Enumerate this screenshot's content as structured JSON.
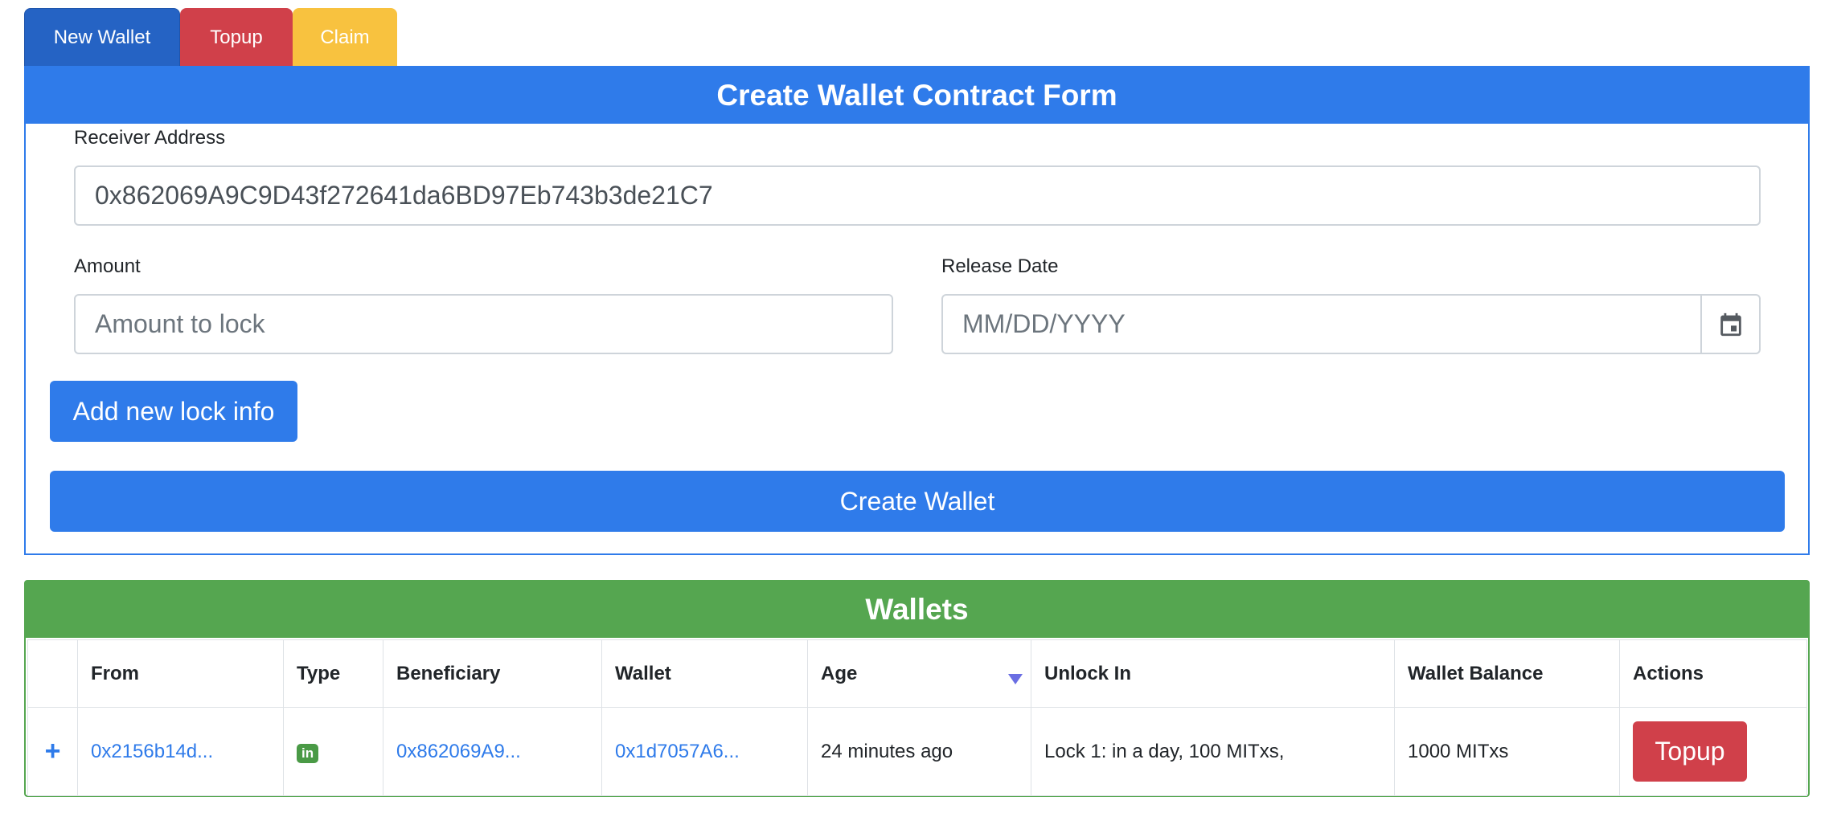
{
  "tabs": [
    {
      "label": "New Wallet",
      "color": "#2563c4"
    },
    {
      "label": "Topup",
      "color": "#d0404a"
    },
    {
      "label": "Claim",
      "color": "#f8c23f"
    }
  ],
  "form": {
    "title": "Create Wallet Contract Form",
    "receiver_label": "Receiver Address",
    "receiver_value": "0x862069A9C9D43f272641da6BD97Eb743b3de21C7",
    "amount_label": "Amount",
    "amount_placeholder": "Amount to lock",
    "release_label": "Release Date",
    "release_placeholder": "MM/DD/YYYY",
    "calendar_icon": "calendar-icon",
    "add_lock_label": "Add new lock info",
    "create_label": "Create Wallet",
    "accent_color": "#2f7bea"
  },
  "wallets": {
    "title": "Wallets",
    "accent_color": "#55a650",
    "columns": [
      "",
      "From",
      "Type",
      "Beneficiary",
      "Wallet",
      "Age",
      "Unlock In",
      "Wallet Balance",
      "Actions"
    ],
    "sorted_column": "Age",
    "rows": [
      {
        "expand": "+",
        "from": "0x2156b14d...",
        "type": "in",
        "beneficiary": "0x862069A9...",
        "wallet": "0x1d7057A6...",
        "age": "24 minutes ago",
        "unlock_in": "Lock 1: in a day, 100 MITxs,",
        "balance": "1000 MITxs",
        "action": "Topup"
      }
    ]
  }
}
